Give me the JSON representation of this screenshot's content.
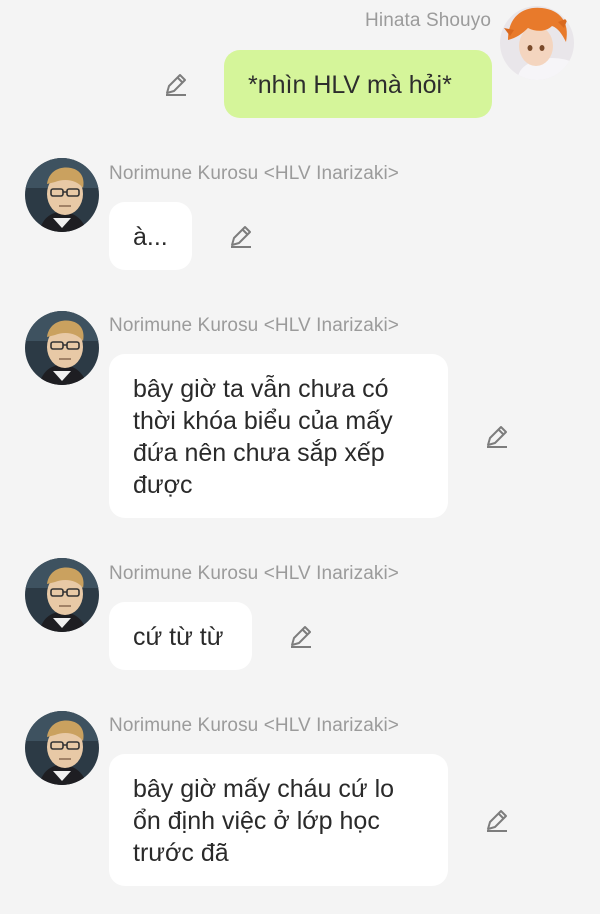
{
  "messages": [
    {
      "sender": "Hinata Shouyo",
      "text": "*nhìn HLV mà hỏi*",
      "own": true
    },
    {
      "sender": "Norimune Kurosu <HLV Inarizaki>",
      "text": "à...",
      "own": false
    },
    {
      "sender": "Norimune Kurosu <HLV Inarizaki>",
      "text": "bây giờ ta vẫn chưa có thời khóa biểu của mấy đứa nên chưa sắp xếp được",
      "own": false
    },
    {
      "sender": "Norimune Kurosu <HLV Inarizaki>",
      "text": "cứ từ từ",
      "own": false
    },
    {
      "sender": "Norimune Kurosu <HLV Inarizaki>",
      "text": "bây giờ mấy cháu cứ lo ổn định việc ở lớp học trước đã",
      "own": false
    }
  ],
  "icons": {
    "edit": "pencil-edit-icon"
  },
  "colors": {
    "background": "#f4f4f4",
    "own_bubble": "#d5f59a",
    "other_bubble": "#ffffff",
    "sender_name": "#9b9b9b"
  }
}
